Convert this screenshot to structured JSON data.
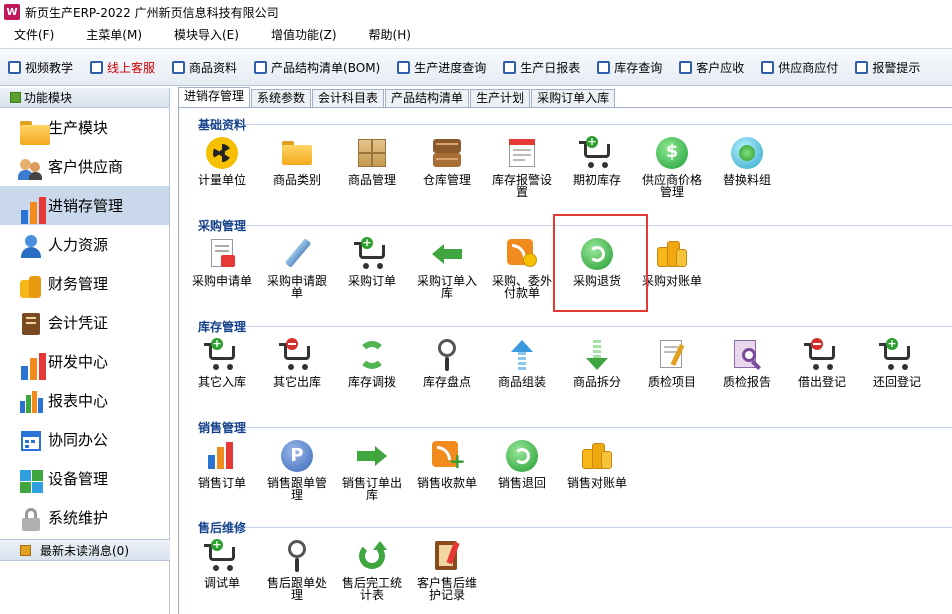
{
  "window": {
    "title": "新页生产ERP-2022 广州新页信息科技有限公司",
    "icon": "app-logo-icon"
  },
  "menu": [
    {
      "label": "文件(F)"
    },
    {
      "label": "主菜单(M)"
    },
    {
      "label": "模块导入(E)"
    },
    {
      "label": "增值功能(Z)"
    },
    {
      "label": "帮助(H)"
    }
  ],
  "toolbar": [
    {
      "label": "视频教学",
      "highlight": false
    },
    {
      "label": "线上客服",
      "highlight": true
    },
    {
      "label": "商品资料",
      "highlight": false
    },
    {
      "label": "产品结构清单(BOM)",
      "highlight": false
    },
    {
      "label": "生产进度查询",
      "highlight": false
    },
    {
      "label": "生产日报表",
      "highlight": false
    },
    {
      "label": "库存查询",
      "highlight": false
    },
    {
      "label": "客户应收",
      "highlight": false
    },
    {
      "label": "供应商应付",
      "highlight": false
    },
    {
      "label": "报警提示",
      "highlight": false
    }
  ],
  "sidebar": {
    "header": "功能模块",
    "items": [
      {
        "label": "生产模块",
        "icon": "folder-icon",
        "active": false
      },
      {
        "label": "客户供应商",
        "icon": "users-icon",
        "active": false
      },
      {
        "label": "进销存管理",
        "icon": "bar-chart-icon",
        "active": true
      },
      {
        "label": "人力资源",
        "icon": "person-icon",
        "active": false
      },
      {
        "label": "财务管理",
        "icon": "coins-icon",
        "active": false
      },
      {
        "label": "会计凭证",
        "icon": "ledger-icon",
        "active": false
      },
      {
        "label": "研发中心",
        "icon": "bar-chart-icon",
        "active": false
      },
      {
        "label": "报表中心",
        "icon": "report-chart-icon",
        "active": false
      },
      {
        "label": "协同办公",
        "icon": "calendar-icon",
        "active": false
      },
      {
        "label": "设备管理",
        "icon": "device-icon",
        "active": false
      },
      {
        "label": "系统维护",
        "icon": "lock-icon",
        "active": false
      }
    ],
    "footer": "最新未读消息(0)"
  },
  "tabs": [
    {
      "label": "进销存管理",
      "active": true
    },
    {
      "label": "系统参数",
      "active": false
    },
    {
      "label": "会计科目表",
      "active": false
    },
    {
      "label": "产品结构清单",
      "active": false
    },
    {
      "label": "生产计划",
      "active": false
    },
    {
      "label": "采购订单入库",
      "active": false
    }
  ],
  "sections": [
    {
      "title": "基础资料",
      "items": [
        {
          "l1": "计量单位",
          "l2": "",
          "icon": "radiation-icon"
        },
        {
          "l1": "商品类别",
          "l2": "",
          "icon": "folder-icon"
        },
        {
          "l1": "商品管理",
          "l2": "",
          "icon": "box-icon"
        },
        {
          "l1": "仓库管理",
          "l2": "",
          "icon": "warehouse-boxes-icon"
        },
        {
          "l1": "库存报警设",
          "l2": "置",
          "icon": "calendar-alert-icon"
        },
        {
          "l1": "期初库存",
          "l2": "",
          "icon": "cart-plus-icon"
        },
        {
          "l1": "供应商价格",
          "l2": "管理",
          "icon": "green-dollar-icon"
        },
        {
          "l1": "替换料组",
          "l2": "",
          "icon": "green-orb-icon"
        }
      ]
    },
    {
      "title": "采购管理",
      "items": [
        {
          "l1": "采购申请单",
          "l2": "",
          "icon": "document-pen-icon"
        },
        {
          "l1": "采购申请跟",
          "l2": "单",
          "icon": "pencil-icon"
        },
        {
          "l1": "采购订单",
          "l2": "",
          "icon": "cart-plus-icon"
        },
        {
          "l1": "采购订单入",
          "l2": "库",
          "icon": "arrow-left-icon"
        },
        {
          "l1": "采购、委外",
          "l2": "付款单",
          "icon": "rss-dollar-icon"
        },
        {
          "l1": "采购退货",
          "l2": "",
          "icon": "green-return-icon"
        },
        {
          "l1": "采购对账单",
          "l2": "",
          "icon": "gold-coins-icon"
        }
      ]
    },
    {
      "title": "库存管理",
      "items": [
        {
          "l1": "其它入库",
          "l2": "",
          "icon": "cart-plus-icon"
        },
        {
          "l1": "其它出库",
          "l2": "",
          "icon": "cart-minus-icon"
        },
        {
          "l1": "库存调拨",
          "l2": "",
          "icon": "refresh-arrows-icon"
        },
        {
          "l1": "库存盘点",
          "l2": "",
          "icon": "magnifier-icon"
        },
        {
          "l1": "商品组装",
          "l2": "",
          "icon": "arrow-up-icon"
        },
        {
          "l1": "商品拆分",
          "l2": "",
          "icon": "arrow-down-icon"
        },
        {
          "l1": "质检项目",
          "l2": "",
          "icon": "note-pencil-icon"
        },
        {
          "l1": "质检报告",
          "l2": "",
          "icon": "report-magnifier-icon"
        },
        {
          "l1": "借出登记",
          "l2": "",
          "icon": "cart-minus-icon"
        },
        {
          "l1": "还回登记",
          "l2": "",
          "icon": "cart-plus-icon"
        }
      ]
    },
    {
      "title": "销售管理",
      "items": [
        {
          "l1": "销售订单",
          "l2": "",
          "icon": "bar-chart-icon"
        },
        {
          "l1": "销售跟单管",
          "l2": "理",
          "icon": "parking-p-icon"
        },
        {
          "l1": "销售订单出",
          "l2": "库",
          "icon": "arrow-right-icon"
        },
        {
          "l1": "销售收款单",
          "l2": "",
          "icon": "rss-plus-icon"
        },
        {
          "l1": "销售退回",
          "l2": "",
          "icon": "green-return-icon"
        },
        {
          "l1": "销售对账单",
          "l2": "",
          "icon": "gold-coins-icon"
        }
      ]
    },
    {
      "title": "售后维修",
      "items": [
        {
          "l1": "调试单",
          "l2": "",
          "icon": "cart-plus-icon"
        },
        {
          "l1": "售后跟单处",
          "l2": "理",
          "icon": "magnifier-icon"
        },
        {
          "l1": "售后完工统",
          "l2": "计表",
          "icon": "green-refresh-icon"
        },
        {
          "l1": "客户售后维",
          "l2": "护记录",
          "icon": "notebook-icon"
        }
      ]
    }
  ],
  "colors": {
    "accent": "#15428b",
    "highlight_box": "#e53935",
    "active_sidebar": "#c9d8ea",
    "red_text": "#d00000"
  }
}
